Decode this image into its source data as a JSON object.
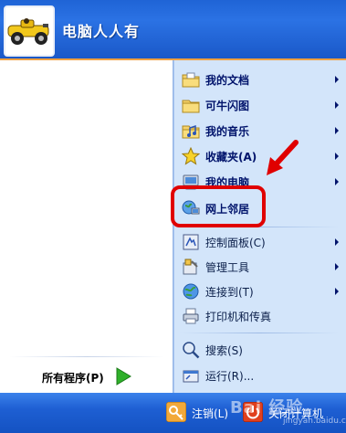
{
  "user": {
    "name": "电脑人人有"
  },
  "left": {
    "all_programs": "所有程序(P)"
  },
  "right": {
    "items": [
      {
        "label": "我的文档",
        "icon": "documents-folder-icon",
        "arrow": true,
        "bold": true
      },
      {
        "label": "可牛闪图",
        "icon": "folder-icon",
        "arrow": true,
        "bold": true
      },
      {
        "label": "我的音乐",
        "icon": "music-folder-icon",
        "arrow": true,
        "bold": true
      },
      {
        "label": "收藏夹(A)",
        "icon": "star-icon",
        "arrow": true,
        "bold": true
      },
      {
        "label": "我的电脑",
        "icon": "computer-icon",
        "arrow": true,
        "bold": true
      },
      {
        "label": "网上邻居",
        "icon": "network-icon",
        "arrow": false,
        "bold": true
      },
      {
        "label": "控制面板(C)",
        "icon": "control-panel-icon",
        "arrow": true,
        "bold": false
      },
      {
        "label": "管理工具",
        "icon": "admin-tools-icon",
        "arrow": true,
        "bold": false
      },
      {
        "label": "连接到(T)",
        "icon": "globe-icon",
        "arrow": true,
        "bold": false
      },
      {
        "label": "打印机和传真",
        "icon": "printer-icon",
        "arrow": false,
        "bold": false
      },
      {
        "label": "搜索(S)",
        "icon": "search-icon",
        "arrow": false,
        "bold": false
      },
      {
        "label": "运行(R)...",
        "icon": "run-icon",
        "arrow": false,
        "bold": false
      }
    ]
  },
  "footer": {
    "logoff": "注销(L)",
    "shutdown": "关闭计算机"
  },
  "watermark": {
    "text": "Bai 经验",
    "sub": "jingyan.baidu.com"
  },
  "colors": {
    "header": "#1f64d6",
    "right_pane": "#d3e5fa",
    "highlight": "#e00000",
    "footer": "#1e5fd3"
  }
}
